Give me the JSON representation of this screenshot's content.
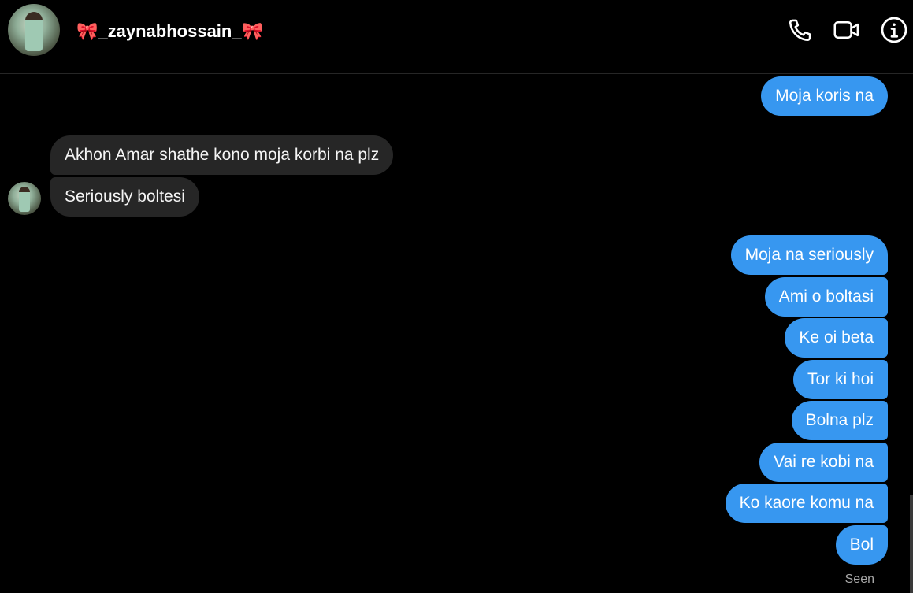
{
  "header": {
    "bow_left": "🎀",
    "username": "_zaynabhossain_",
    "bow_right": "🎀",
    "icons": [
      "phone-icon",
      "video-camera-icon",
      "info-icon"
    ]
  },
  "messages": {
    "m1": "Moja koris na",
    "m2": "Akhon Amar shathe kono moja korbi na plz",
    "m3": "Seriously boltesi",
    "m4": "Moja na seriously",
    "m5": "Ami o boltasi",
    "m6": "Ke oi beta",
    "m7": "Tor ki hoi",
    "m8": "Bolna plz",
    "m9": "Vai re kobi na",
    "m10": "Ko kaore komu na",
    "m11": "Bol"
  },
  "status": {
    "seen": "Seen"
  },
  "colors": {
    "outgoing_bubble": "#3797f0",
    "incoming_bubble": "#262626",
    "background": "#000000"
  }
}
